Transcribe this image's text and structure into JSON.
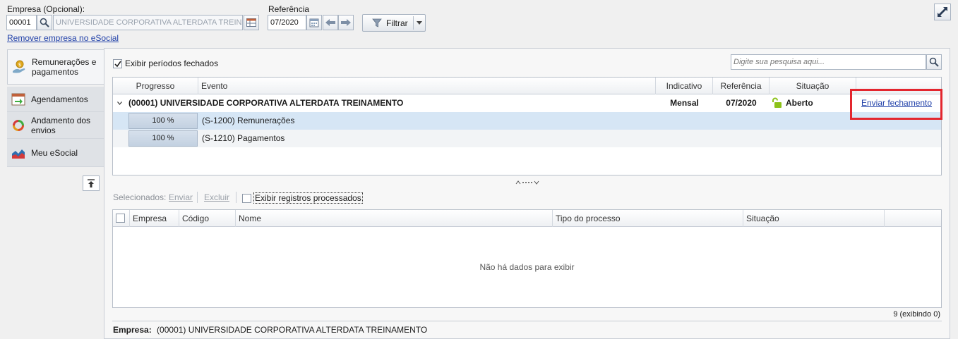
{
  "header": {
    "empresa_label": "Empresa (Opcional):",
    "empresa_code": "00001",
    "empresa_name": "UNIVERSIDADE CORPORATIVA ALTERDATA TREINAMENTO",
    "referencia_label": "Referência",
    "referencia_value": "07/2020",
    "filtrar_label": "Filtrar",
    "remover_link": "Remover empresa no eSocial"
  },
  "sidebar": {
    "items": [
      {
        "label": "Remunerações e pagamentos"
      },
      {
        "label": "Agendamentos"
      },
      {
        "label": "Andamento dos envios"
      },
      {
        "label": "Meu eSocial"
      }
    ]
  },
  "main": {
    "show_closed_label": "Exibir períodos fechados",
    "search_placeholder": "Digite sua pesquisa aqui...",
    "columns": [
      "Progresso",
      "Evento",
      "Indicativo",
      "Referência",
      "Situação"
    ],
    "group": {
      "name": "(00001) UNIVERSIDADE CORPORATIVA ALTERDATA TREINAMENTO",
      "indicativo": "Mensal",
      "referencia": "07/2020",
      "situacao": "Aberto",
      "action": "Enviar fechamento"
    },
    "rows": [
      {
        "progress": "100 %",
        "event": "(S-1200) Remunerações"
      },
      {
        "progress": "100 %",
        "event": "(S-1210) Pagamentos"
      }
    ]
  },
  "lower": {
    "selected_label": "Selecionados:",
    "enviar_label": "Enviar",
    "excluir_label": "Excluir",
    "show_processed_label": "Exibir registros processados",
    "columns": [
      "Empresa",
      "Código",
      "Nome",
      "Tipo do processo",
      "Situação"
    ],
    "empty_text": "Não há dados para exibir",
    "count_text": "9 (exibindo 0)"
  },
  "footer": {
    "empresa_label": "Empresa:",
    "empresa_value": "(00001) UNIVERSIDADE CORPORATIVA ALTERDATA TREINAMENTO"
  },
  "colors": {
    "highlight": "#e3262e",
    "link": "#1f3fa8",
    "row_selected": "#d6e6f5"
  }
}
